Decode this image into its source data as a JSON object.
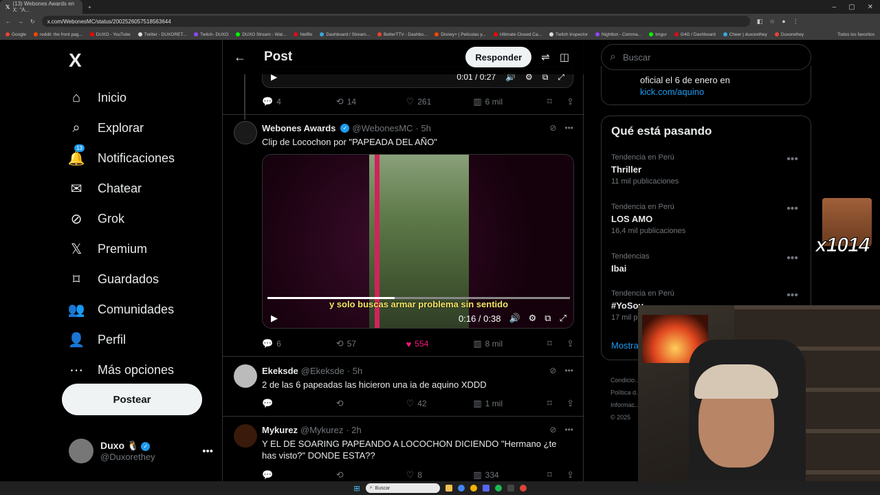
{
  "browser": {
    "tab_title": "(13) Webones Awards en X: \"A...",
    "url": "x.com/WebonesMC/status/2002526057518563644",
    "bookmarks": [
      "Google",
      "reddit: the front pag...",
      "DUXO - YouTube",
      "Twitter - DUXORET...",
      "Twitch- DUXO",
      "DUXO Stream - Wat...",
      "Netflix",
      "Dashboard / Stream...",
      "BetterTTV - Dashbo...",
      "Disney+ | Películas y...",
      "Ultimate Closed Ca...",
      "Twitch Inspector",
      "Nightbot - Comma...",
      "Imgur",
      "G4G / Dashboard",
      "Cheer | duxorethey",
      "Duxorethey"
    ],
    "all_bookmarks": "Todos los favoritos"
  },
  "sidebar": {
    "logo": "X",
    "items": [
      {
        "label": "Inicio",
        "icon": "home-icon",
        "glyph": "⌂"
      },
      {
        "label": "Explorar",
        "icon": "search-icon",
        "glyph": "⌕"
      },
      {
        "label": "Notificaciones",
        "icon": "bell-icon",
        "glyph": "🔔"
      },
      {
        "label": "Chatear",
        "icon": "mail-icon",
        "glyph": "✉"
      },
      {
        "label": "Grok",
        "icon": "grok-icon",
        "glyph": "⊘"
      },
      {
        "label": "Premium",
        "icon": "x-premium-icon",
        "glyph": "𝕏"
      },
      {
        "label": "Guardados",
        "icon": "bookmark-icon",
        "glyph": "⌑"
      },
      {
        "label": "Comunidades",
        "icon": "communities-icon",
        "glyph": "👥"
      },
      {
        "label": "Perfil",
        "icon": "profile-icon",
        "glyph": "👤"
      },
      {
        "label": "Más opciones",
        "icon": "more-icon",
        "glyph": "⋯"
      }
    ],
    "notif_badge": "13",
    "post_button": "Postear",
    "profile": {
      "name": "Duxo",
      "emoji": "🐧",
      "handle": "@Duxorethey"
    }
  },
  "header": {
    "title": "Post",
    "reply_button": "Responder"
  },
  "top_video": {
    "time": "0:01 / 0:27"
  },
  "top_actions": {
    "replies": "4",
    "reposts": "14",
    "likes": "261",
    "views": "6 mil"
  },
  "tweets": [
    {
      "name": "Webones Awards",
      "handle": "@WebonesMC",
      "time": "· 5h",
      "text": "Clip de Locochon por \"PAPEADA DEL AÑO\"",
      "replies": "6",
      "reposts": "57",
      "likes": "554",
      "views": "8 mil",
      "verified": true
    },
    {
      "name": "Ekeksde",
      "handle": "@Ekeksde",
      "time": "· 5h",
      "text": "2 de las 6 papeadas las hicieron una ia de aquino XDDD",
      "replies": "",
      "reposts": "",
      "likes": "42",
      "views": "1 mil"
    },
    {
      "name": "Mykurez",
      "handle": "@Mykurez",
      "time": "· 2h",
      "text": "Y EL DE SOARING PAPEANDO A LOCOCHON DICIENDO \"Hermano ¿te has visto?\" DONDE ESTA??",
      "replies": "",
      "reposts": "",
      "likes": "8",
      "views": "334"
    }
  ],
  "video": {
    "subtitle": "y solo buscas armar problema sin sentido",
    "time": "0:16 / 0:38",
    "progress": 0.42
  },
  "right": {
    "search_placeholder": "Buscar",
    "card_top_text": "oficial el 6 de enero en",
    "card_top_link": "kick.com/aquino",
    "trends_title": "Qué está pasando",
    "trends": [
      {
        "context": "Tendencia en Perú",
        "name": "Thriller",
        "count": "11 mil publicaciones"
      },
      {
        "context": "Tendencia en Perú",
        "name": "LOS AMO",
        "count": "16,4 mil publicaciones"
      },
      {
        "context": "Tendencias",
        "name": "Ibai",
        "count": ""
      },
      {
        "context": "Tendencia en Perú",
        "name": "#YoSoy...",
        "count": "17 mil p..."
      }
    ],
    "show_more": "Mostrar",
    "footer": [
      "Condicio...",
      "Política d...",
      "Informac...",
      "© 2025"
    ]
  },
  "overlay": {
    "counter": "x1014"
  },
  "taskbar": {
    "search": "Buscar"
  }
}
